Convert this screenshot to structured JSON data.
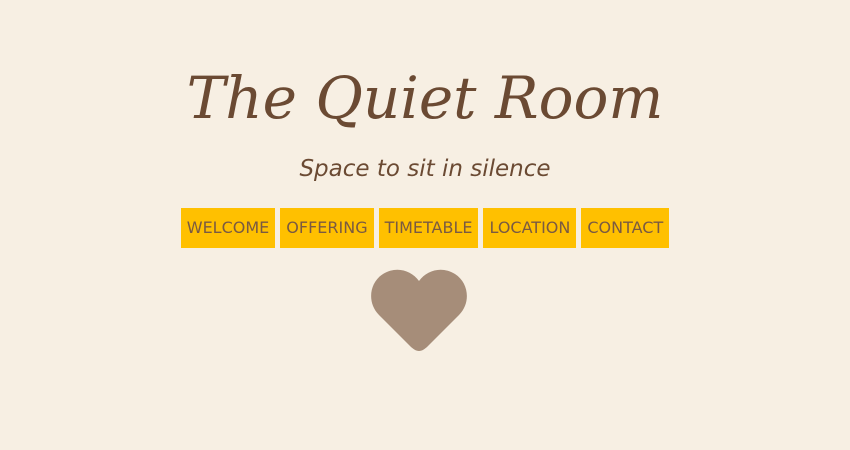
{
  "header": {
    "title": "The Quiet Room",
    "tagline": "Space to sit in silence"
  },
  "nav": {
    "items": [
      {
        "label": "WELCOME"
      },
      {
        "label": "OFFERING"
      },
      {
        "label": "TIMETABLE"
      },
      {
        "label": "LOCATION"
      },
      {
        "label": "CONTACT"
      }
    ]
  },
  "colors": {
    "background": "#f7efe3",
    "text": "#6b4a33",
    "nav_background": "#ffc000",
    "heart": "#a68d79"
  },
  "icons": {
    "heart": "heart-icon"
  }
}
